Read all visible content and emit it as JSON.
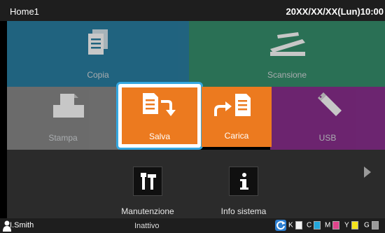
{
  "header": {
    "title": "Home1",
    "datetime": "20XX/XX/XX(Lun)10:00"
  },
  "tiles": {
    "copia": {
      "label": "Copia",
      "icon": "copy-icon",
      "color": "#2a7fa3"
    },
    "scansione": {
      "label": "Scansione",
      "icon": "scanner-icon",
      "color": "#36906d"
    },
    "stampa": {
      "label": "Stampa",
      "icon": "printer-icon",
      "color": "#8a8a8a"
    },
    "salva": {
      "label": "Salva",
      "icon": "save-document-icon",
      "color": "#ec7a1f",
      "selected": true
    },
    "carica": {
      "label": "Carica",
      "icon": "load-document-icon",
      "color": "#ec7a1f"
    },
    "usb": {
      "label": "USB",
      "icon": "usb-icon",
      "color": "#8b2f8f"
    }
  },
  "bottom": {
    "manutenzione": {
      "label": "Manutenzione",
      "icon": "tools-icon"
    },
    "info_sistema": {
      "label": "Info sistema",
      "icon": "info-icon"
    },
    "next_icon": "chevron-right-icon"
  },
  "status": {
    "user": "I.Smith",
    "state": "Inattivo",
    "inks": [
      {
        "label": "K",
        "color": "#f2f2f2"
      },
      {
        "label": "C",
        "color": "#23a7dc"
      },
      {
        "label": "M",
        "color": "#e0458c"
      },
      {
        "label": "Y",
        "color": "#f4e21b"
      },
      {
        "label": "G",
        "color": "#9a9a9a"
      }
    ]
  }
}
